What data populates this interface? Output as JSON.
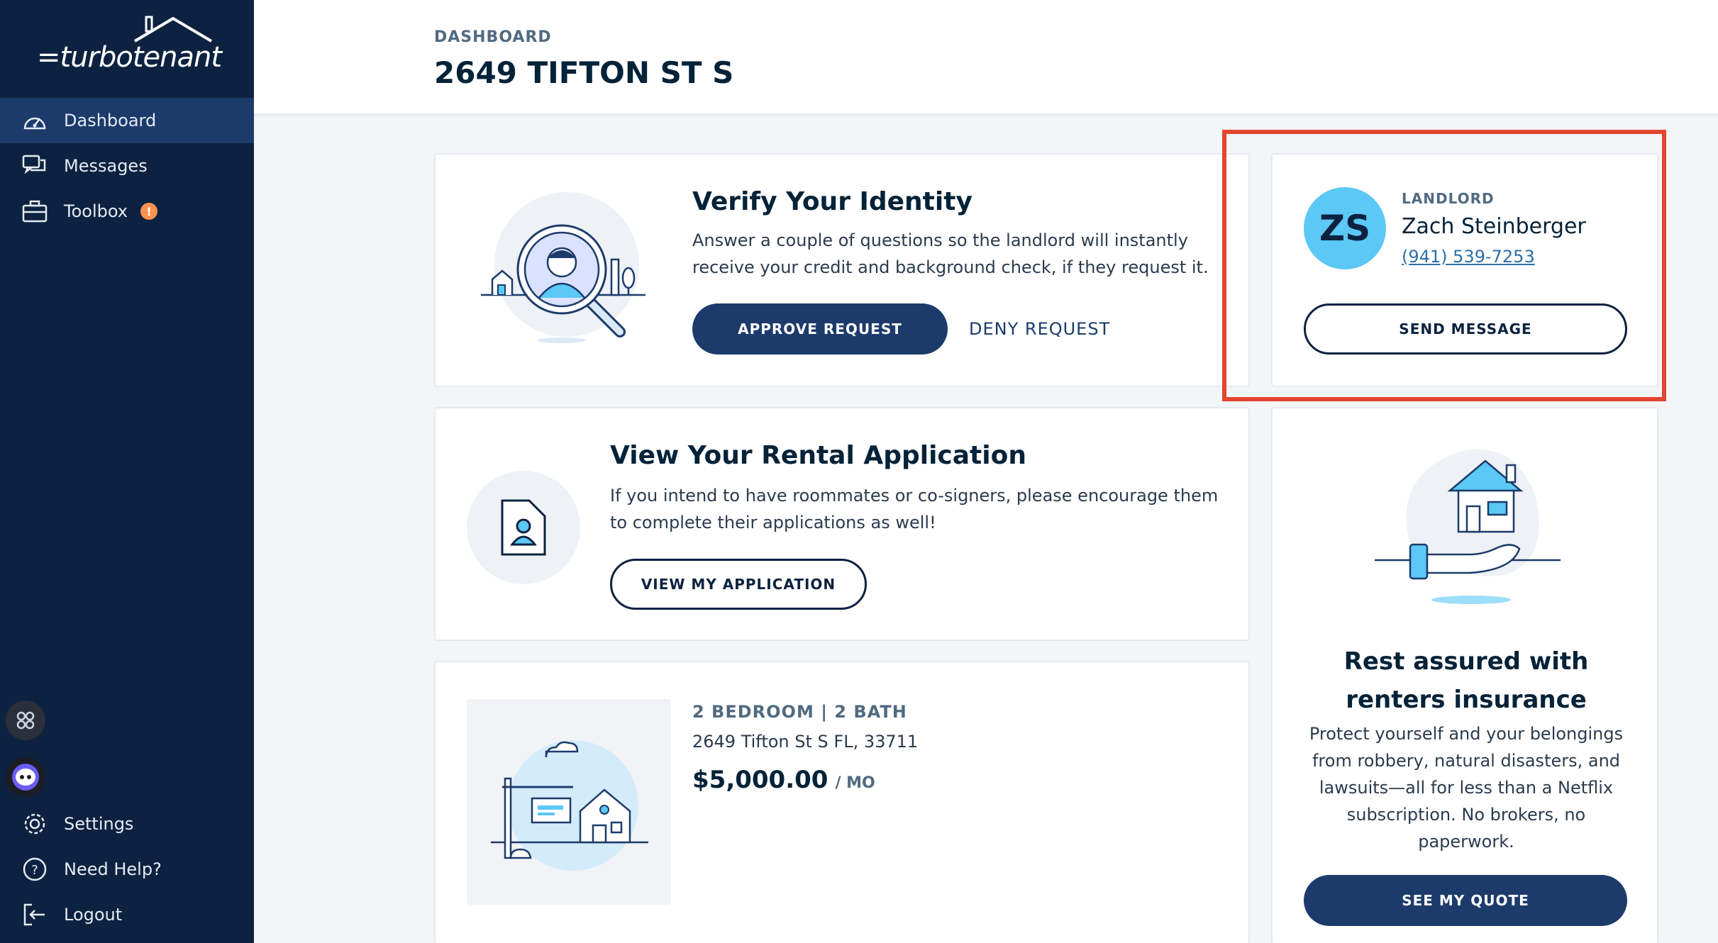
{
  "brand": {
    "name": "=turbotenant"
  },
  "sidebar": {
    "items": [
      {
        "label": "Dashboard",
        "icon": "speedometer-icon",
        "active": true
      },
      {
        "label": "Messages",
        "icon": "chat-bubbles-icon"
      },
      {
        "label": "Toolbox",
        "icon": "toolbox-icon",
        "badge": "!"
      }
    ],
    "bottom_items": [
      {
        "label": "Settings",
        "icon": "gear-icon"
      },
      {
        "label": "Need Help?",
        "icon": "question-circle-icon"
      },
      {
        "label": "Logout",
        "icon": "logout-icon"
      }
    ]
  },
  "header": {
    "breadcrumb": "DASHBOARD",
    "title": "2649 TIFTON ST S"
  },
  "verify": {
    "title": "Verify Your Identity",
    "text_line1": "Answer a couple of questions so the landlord will instantly",
    "text_line2": "receive your credit and background check, if they request it.",
    "approve_label": "APPROVE REQUEST",
    "deny_label": "DENY REQUEST"
  },
  "landlord": {
    "role": "LANDLORD",
    "initials": "ZS",
    "name": "Zach Steinberger",
    "phone": "(941) 539-7253",
    "send_label": "SEND MESSAGE"
  },
  "application": {
    "title": "View Your Rental Application",
    "text_line1": "If you intend to have roommates or co-signers, please encourage them",
    "text_line2": "to complete their applications as well!",
    "button_label": "VIEW MY APPLICATION"
  },
  "property": {
    "beds_baths": "2 BEDROOM | 2 BATH",
    "address": "2649 Tifton St S FL, 33711",
    "rent": "$5,000.00",
    "period": "/ MO"
  },
  "insurance": {
    "title_line1": "Rest assured with",
    "title_line2": "renters insurance",
    "text_lines": [
      "Protect yourself and your belongings",
      "from robbery, natural disasters, and",
      "lawsuits—all for less than a Netflix",
      "subscription. No brokers, no",
      "paperwork."
    ],
    "button_label": "SEE MY QUOTE"
  },
  "colors": {
    "sidebar": "#0d2240",
    "primary": "#1c3b6b",
    "accent": "#5bc8f5",
    "highlight": "#e2462f",
    "badge": "#ff9250"
  }
}
